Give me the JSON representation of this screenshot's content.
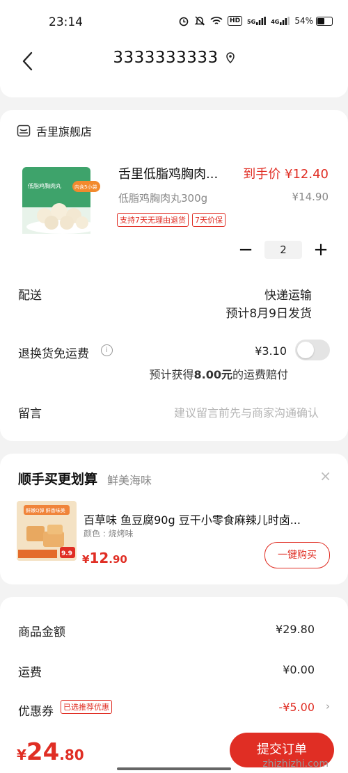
{
  "status_bar": {
    "time": "23:14",
    "battery": "54%",
    "hd": "HD",
    "signal_1": "5G",
    "signal_2": "4G",
    "battery_level": 0.54
  },
  "header": {
    "title": "3333333333"
  },
  "store": {
    "name": "舌里旗舰店"
  },
  "product": {
    "name": "舌里低脂鸡胸肉...",
    "price_label": "到手价 ¥12.40",
    "spec": "低脂鸡胸肉丸300g",
    "original_price": "¥14.90",
    "tags": [
      "支持7天无理由退货",
      "7天价保"
    ],
    "quantity": "2",
    "minus": "−",
    "plus": "+",
    "image_label": "低脂鸡胸肉丸",
    "image_badge": "内含5小袋"
  },
  "delivery": {
    "label": "配送",
    "method": "快递运输",
    "eta": "预计8月9日发货"
  },
  "return_shipping": {
    "label": "退换货免运费",
    "price": "¥3.10",
    "note_prefix": "预计获得",
    "note_amount": "8.00元",
    "note_suffix": "的运费赔付"
  },
  "message": {
    "label": "留言",
    "placeholder": "建议留言前先与商家沟通确认"
  },
  "recommend": {
    "title": "顺手买更划算",
    "subtitle": "鲜美海味",
    "close": "×",
    "item_name": "百草味 鱼豆腐90g 豆干小零食麻辣儿时卤...",
    "item_spec": "颜色 : 烧烤味",
    "price_symbol": "¥",
    "price_int": "12",
    "price_dec": ".90",
    "buy_label": "一键购买",
    "image_banner": "鲜嫩Q弹 鲜香味美",
    "image_price": "9.9"
  },
  "summary": {
    "goods_label": "商品金额",
    "goods_value": "¥29.80",
    "shipping_label": "运费",
    "shipping_value": "¥0.00",
    "coupon_label": "优惠券",
    "coupon_badge": "已选推荐优惠",
    "coupon_value": "-¥5.00",
    "chevron": "›"
  },
  "footer": {
    "total_symbol": "¥",
    "total_int": "24",
    "total_dec": ".80",
    "submit_label": "提交订单",
    "watermark": "zhizhizhi.com"
  },
  "colors": {
    "accent": "#e02e24",
    "background": "#f3f3f3"
  }
}
